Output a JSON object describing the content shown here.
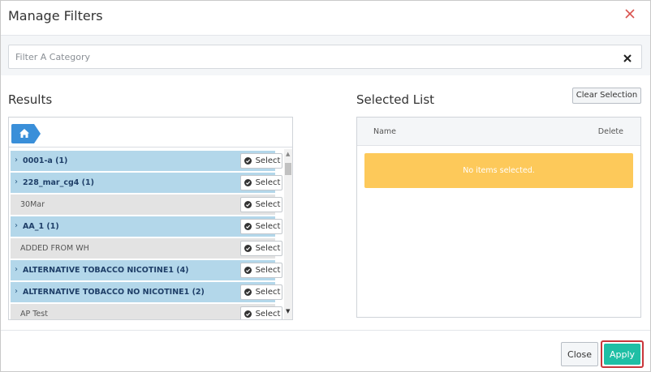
{
  "dialog": {
    "title": "Manage Filters"
  },
  "filter": {
    "placeholder": "Filter A Category",
    "value": ""
  },
  "results": {
    "title": "Results",
    "select_label": "Select",
    "items": [
      {
        "label": "0001-a (1)",
        "type": "folder"
      },
      {
        "label": "228_mar_cg4 (1)",
        "type": "folder"
      },
      {
        "label": "30Mar",
        "type": "leaf"
      },
      {
        "label": "AA_1 (1)",
        "type": "folder"
      },
      {
        "label": "ADDED FROM WH",
        "type": "leaf"
      },
      {
        "label": "ALTERNATIVE TOBACCO NICOTINE1 (4)",
        "type": "folder"
      },
      {
        "label": "ALTERNATIVE TOBACCO NO NICOTINE1 (2)",
        "type": "folder"
      },
      {
        "label": "AP Test",
        "type": "leaf"
      }
    ]
  },
  "selected": {
    "title": "Selected List",
    "clear_label": "Clear Selection",
    "col_name": "Name",
    "col_delete": "Delete",
    "empty_message": "No items selected."
  },
  "footer": {
    "close_label": "Close",
    "apply_label": "Apply"
  },
  "colors": {
    "folder_row": "#b3d7ea",
    "leaf_row": "#e3e3e3",
    "home_crumb": "#3a8fd9",
    "empty_notice": "#fdc95a",
    "apply_button": "#1fbfa5",
    "apply_highlight": "#c9363b",
    "close_x": "#d9534f"
  },
  "icons": {
    "close": "close-icon",
    "clear_filter": "clear-icon",
    "home": "home-icon",
    "expand": "chevron-right-icon",
    "select": "check-circle-icon"
  }
}
